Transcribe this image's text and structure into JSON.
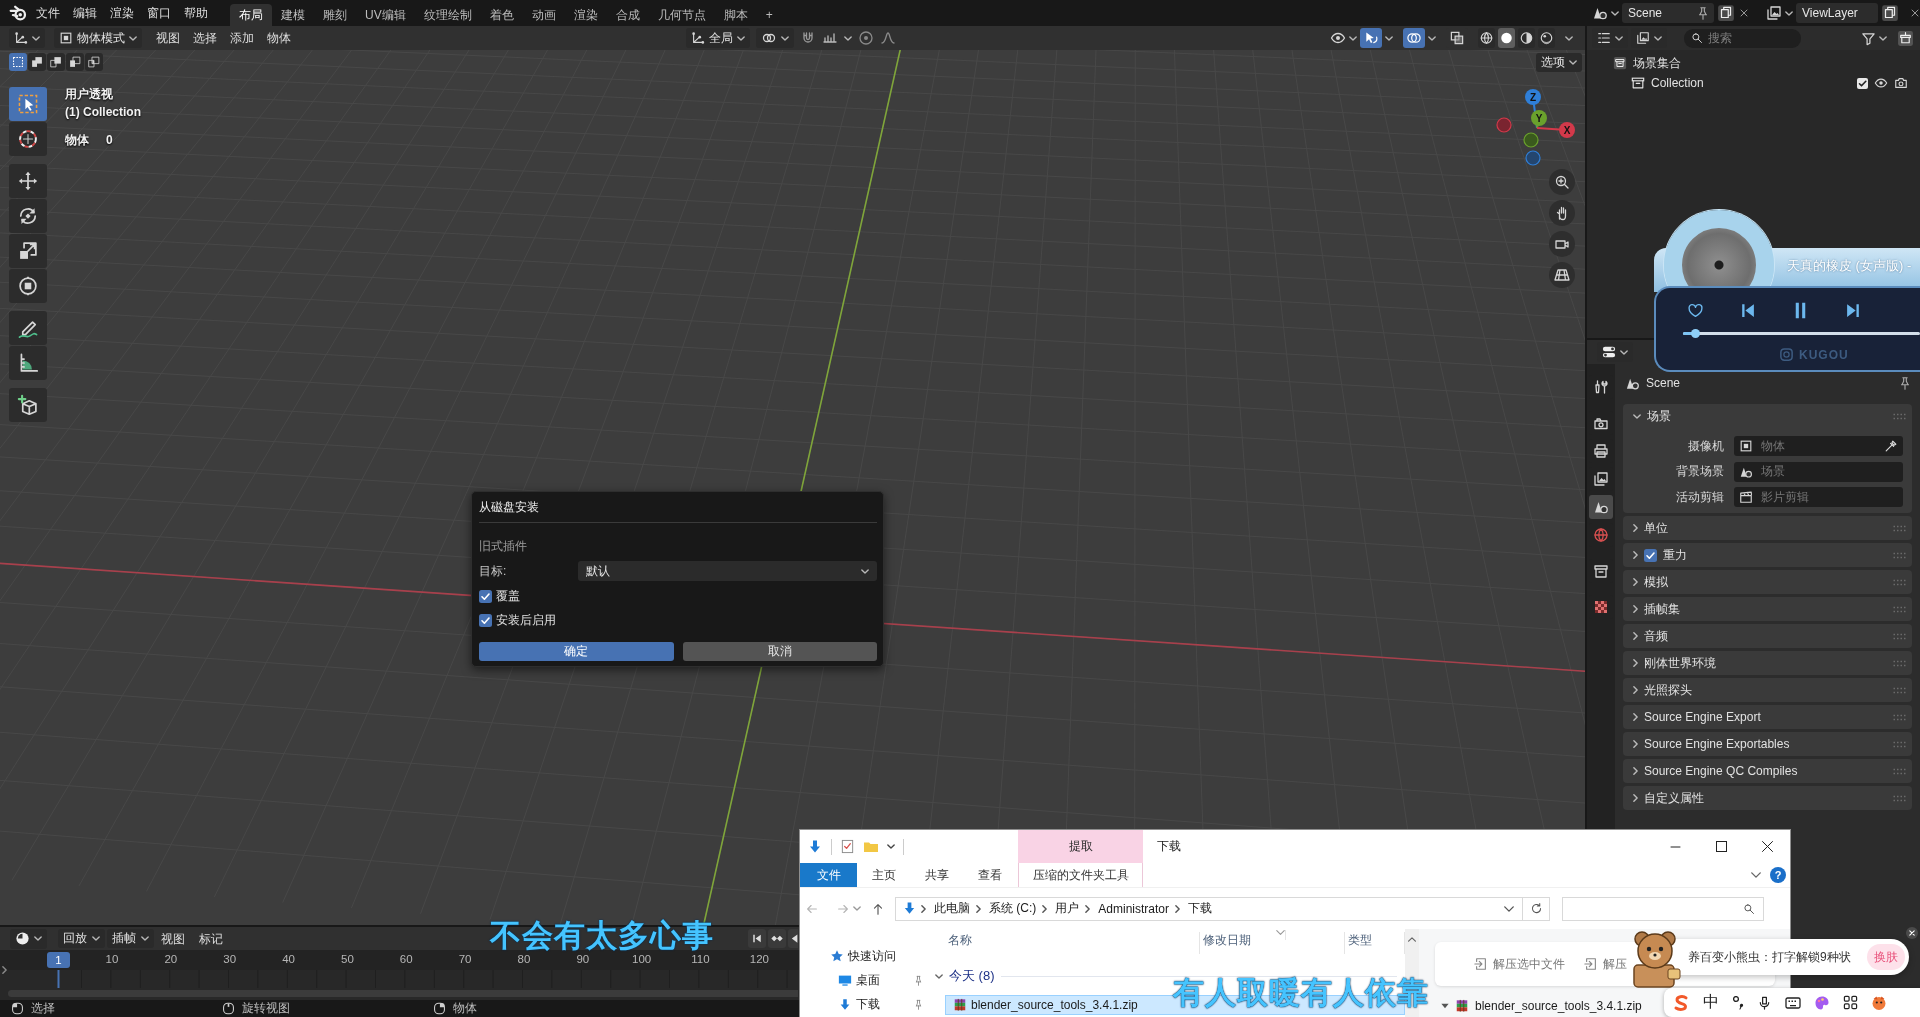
{
  "topbar": {
    "menus": [
      "文件",
      "编辑",
      "渲染",
      "窗口",
      "帮助"
    ],
    "workspaces": [
      {
        "label": "布局",
        "selected": true
      },
      {
        "label": "建模",
        "selected": false
      },
      {
        "label": "雕刻",
        "selected": false
      },
      {
        "label": "UV编辑",
        "selected": false
      },
      {
        "label": "纹理绘制",
        "selected": false
      },
      {
        "label": "着色",
        "selected": false
      },
      {
        "label": "动画",
        "selected": false
      },
      {
        "label": "渲染",
        "selected": false
      },
      {
        "label": "合成",
        "selected": false
      },
      {
        "label": "几何节点",
        "selected": false
      },
      {
        "label": "脚本",
        "selected": false
      }
    ],
    "add_workspace": "+",
    "scene": "Scene",
    "view_layer": "ViewLayer"
  },
  "viewport": {
    "mode": "物体模式",
    "menus": [
      "视图",
      "选择",
      "添加",
      "物体"
    ],
    "orientation": "全局",
    "options": "选项",
    "select_modes": [
      {
        "kind": "set",
        "selected": true
      },
      {
        "kind": "extend",
        "selected": false
      },
      {
        "kind": "subtract",
        "selected": false
      },
      {
        "kind": "invert",
        "selected": false
      },
      {
        "kind": "intersect",
        "selected": false
      }
    ],
    "toggles": [
      {
        "kind": "gizmo",
        "on": true
      },
      {
        "kind": "overlay",
        "on": true
      },
      {
        "kind": "xray",
        "on": false
      }
    ],
    "shading": [
      {
        "kind": "wireframe",
        "selected": false
      },
      {
        "kind": "solid",
        "selected": true
      },
      {
        "kind": "material",
        "selected": false
      },
      {
        "kind": "rendered",
        "selected": false
      }
    ],
    "info": {
      "view": "用户透视",
      "collection": "(1) Collection",
      "stat_label": "物体",
      "stat_value": "0"
    },
    "tool_groups": [
      {
        "tools": [
          {
            "kind": "select",
            "selected": true
          },
          {
            "kind": "cursor",
            "selected": false
          }
        ]
      },
      {
        "tools": [
          {
            "kind": "move",
            "selected": false
          },
          {
            "kind": "rotate",
            "selected": false
          },
          {
            "kind": "scale",
            "selected": false
          },
          {
            "kind": "transform",
            "selected": false
          }
        ]
      },
      {
        "tools": [
          {
            "kind": "annotate",
            "selected": false
          },
          {
            "kind": "measure",
            "selected": false
          }
        ]
      },
      {
        "tools": [
          {
            "kind": "add_cube",
            "selected": false
          }
        ]
      }
    ],
    "gizmo_axes": [
      {
        "label": "Z",
        "kind": "z"
      },
      {
        "label": "Y",
        "kind": "y"
      },
      {
        "label": "X",
        "kind": "x"
      }
    ]
  },
  "dialog": {
    "title": "从磁盘安装",
    "section": "旧式插件",
    "target_label": "目标:",
    "target_value": "默认",
    "options": [
      {
        "label": "覆盖",
        "checked": true
      },
      {
        "label": "安装后启用",
        "checked": true
      }
    ],
    "buttons": [
      {
        "label": "确定",
        "kind": "primary"
      },
      {
        "label": "取消",
        "kind": "secondary"
      }
    ]
  },
  "outliner": {
    "search_placeholder": "搜索",
    "tree": [
      {
        "label": "场景集合",
        "kind": "scene_collection",
        "children": [
          {
            "label": "Collection",
            "kind": "collection",
            "checked": true
          }
        ]
      }
    ]
  },
  "properties": {
    "tab_groups": [
      {
        "tabs": [
          {
            "kind": "tool",
            "selected": false
          }
        ]
      },
      {
        "tabs": [
          {
            "kind": "render",
            "selected": false
          },
          {
            "kind": "output",
            "selected": false
          },
          {
            "kind": "view_layer",
            "selected": false
          },
          {
            "kind": "scene",
            "selected": true
          },
          {
            "kind": "world",
            "selected": false
          }
        ]
      },
      {
        "tabs": [
          {
            "kind": "collection",
            "selected": false
          }
        ]
      },
      {
        "tabs": [
          {
            "kind": "texture",
            "selected": false
          }
        ]
      }
    ],
    "context": "Scene",
    "panels": [
      {
        "label": "场景",
        "kind": "plain",
        "expanded": true,
        "fields": [
          {
            "label": "摄像机",
            "kind": "object",
            "placeholder": "物体",
            "eyedropper": true
          },
          {
            "label": "背景场景",
            "kind": "scene",
            "placeholder": "场景",
            "eyedropper": false
          },
          {
            "label": "活动剪辑",
            "kind": "clip",
            "placeholder": "影片剪辑",
            "eyedropper": false
          }
        ]
      },
      {
        "label": "单位",
        "kind": "plain",
        "expanded": false
      },
      {
        "label": "重力",
        "kind": "toggle",
        "checked": true,
        "expanded": false
      },
      {
        "label": "模拟",
        "kind": "plain",
        "expanded": false
      },
      {
        "label": "插帧集",
        "kind": "plain",
        "expanded": false
      },
      {
        "label": "音频",
        "kind": "plain",
        "expanded": false
      },
      {
        "label": "刚体世界环境",
        "kind": "plain",
        "expanded": false
      },
      {
        "label": "光照探头",
        "kind": "plain",
        "expanded": false
      },
      {
        "label": "Source Engine Export",
        "kind": "plain",
        "expanded": false
      },
      {
        "label": "Source Engine Exportables",
        "kind": "plain",
        "expanded": false
      },
      {
        "label": "Source Engine QC Compiles",
        "kind": "plain",
        "expanded": false
      },
      {
        "label": "自定义属性",
        "kind": "plain",
        "expanded": false
      }
    ]
  },
  "music_player": {
    "title": "天真的橡皮 (女声版) -",
    "liked": false,
    "level": 0.05,
    "brand": "KUGOU"
  },
  "timeline": {
    "menus": [
      {
        "label": "回放",
        "dropdown": true
      },
      {
        "label": "插帧",
        "dropdown": true
      },
      {
        "label": "视图",
        "dropdown": false
      },
      {
        "label": "标记",
        "dropdown": false
      }
    ],
    "current_frame": "1",
    "ruler": [
      "10",
      "20",
      "30",
      "40",
      "50",
      "60",
      "70",
      "80",
      "90",
      "100",
      "110",
      "120"
    ]
  },
  "status_bar": [
    {
      "label": "选择",
      "kind": "left"
    },
    {
      "label": "旋转视图",
      "kind": "middle"
    },
    {
      "label": "物体",
      "kind": "right"
    }
  ],
  "lyrics": [
    {
      "text": "不会有太多心事",
      "kind": "upper"
    },
    {
      "text": "有人取暖有人依靠",
      "kind": "lower"
    }
  ],
  "explorer": {
    "context_tab": "提取",
    "title": "下载",
    "ribbon_tabs": [
      {
        "label": "文件",
        "kind": "file"
      },
      {
        "label": "主页",
        "kind": "tab"
      },
      {
        "label": "共享",
        "kind": "tab"
      },
      {
        "label": "查看",
        "kind": "tab"
      },
      {
        "label": "压缩的文件夹工具",
        "kind": "context"
      }
    ],
    "help": "?",
    "path": [
      "此电脑",
      "系统 (C:)",
      "用户",
      "Administrator",
      "下载"
    ],
    "nav": [
      {
        "label": "快速访问",
        "kind": "star",
        "pinned": false
      },
      {
        "label": "桌面",
        "kind": "desktop",
        "pinned": true
      },
      {
        "label": "下载",
        "kind": "download",
        "pinned": true
      }
    ],
    "columns": [
      "名称",
      "修改日期",
      "类型"
    ],
    "group": "今天 (8)",
    "rows": [
      {
        "name": "blender_source_tools_3.4.1.zip",
        "selected": true
      }
    ],
    "preview_actions": [
      "解压选中文件",
      "解压"
    ],
    "preview_file": "blender_source_tools_3.4.1.zip"
  },
  "ime": {
    "notice": "养百变小熊虫：打字解锁9种状",
    "skin": "换肤",
    "mode": "中"
  }
}
